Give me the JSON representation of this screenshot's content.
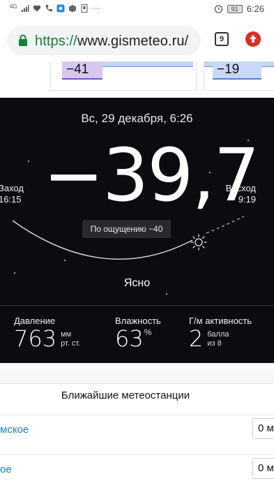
{
  "status_bar": {
    "network_label": "4G",
    "battery": "91",
    "time": "6:26",
    "icons": [
      "signal-icon",
      "heart-monitor-icon",
      "phone-icon",
      "app-icon",
      "box-icon",
      "sd-icon",
      "more-icon",
      "alarm-icon"
    ]
  },
  "browser": {
    "url_scheme": "https://",
    "url_host": "www.gismeteo.ru/",
    "tab_count": "9",
    "accent": "#d93025"
  },
  "top_cards": {
    "chip1": "−41",
    "chip2": "−19"
  },
  "weather": {
    "date": "Вс, 29 декабря, 6:26",
    "temperature": "−39,7",
    "sunset_label": "Заход",
    "sunset_time": "16:15",
    "sunrise_label": "Восход",
    "sunrise_time": "9:19",
    "feels_like": "По ощущению −40",
    "condition": "Ясно",
    "pressure_label": "Давление",
    "pressure_value": "763",
    "pressure_unit_1": "мм",
    "pressure_unit_2": "рт. ст.",
    "humidity_label": "Влажность",
    "humidity_value": "63",
    "humidity_unit": "%",
    "geomag_label": "Г/м активность",
    "geomag_value": "2",
    "geomag_unit_1": "балла",
    "geomag_unit_2": "из 8"
  },
  "stations": {
    "title": "Ближайшие метеостанции",
    "items": [
      {
        "name": "мское",
        "distance": "0 м"
      },
      {
        "name": "oe",
        "distance": "0 м"
      }
    ]
  }
}
